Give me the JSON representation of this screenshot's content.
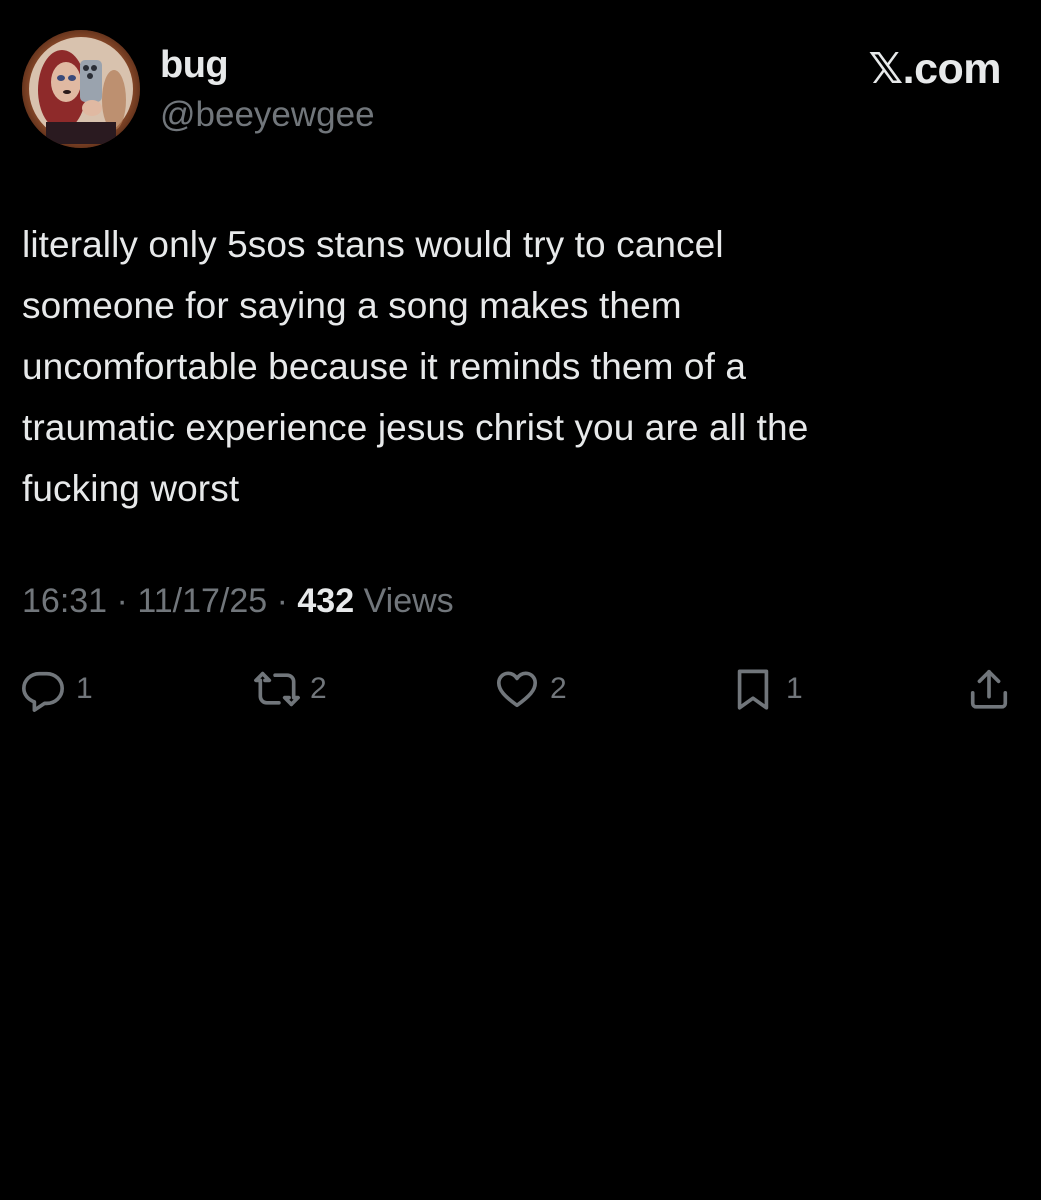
{
  "author": {
    "display_name": "bug",
    "handle": "@beeyewgee"
  },
  "brand": {
    "label": "𝕏.com",
    "icon": "x-logo"
  },
  "tweet": {
    "text": "literally only 5sos stans would try to cancel\nsomeone for saying a song makes them\nuncomfortable because it reminds them of a\ntraumatic experience jesus christ you are all the\nfucking worst"
  },
  "meta": {
    "time": "16:31",
    "separator": "·",
    "date": "11/17/25",
    "views_count": "432",
    "views_label": "Views"
  },
  "actions": {
    "reply": {
      "icon": "reply-icon",
      "count": "1"
    },
    "retweet": {
      "icon": "retweet-icon",
      "count": "2"
    },
    "like": {
      "icon": "heart-icon",
      "count": "2"
    },
    "bookmark": {
      "icon": "bookmark-icon",
      "count": "1"
    },
    "share": {
      "icon": "share-icon"
    }
  },
  "colors": {
    "background": "#000000",
    "text_primary": "#e7e9ea",
    "text_secondary": "#71767b"
  }
}
